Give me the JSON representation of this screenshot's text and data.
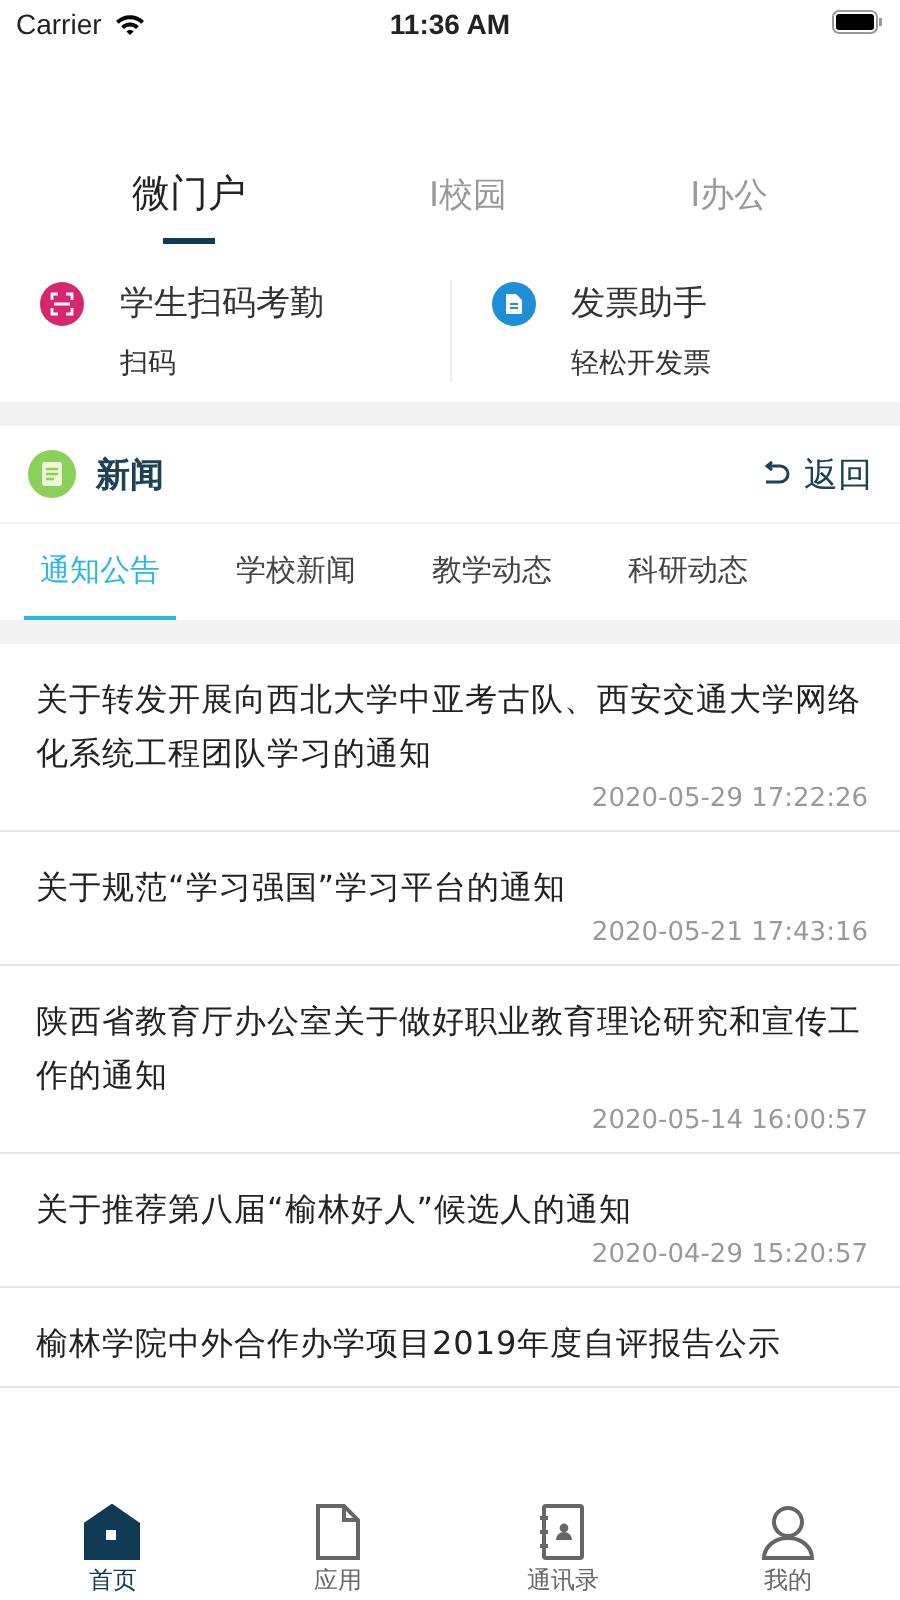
{
  "status_bar": {
    "carrier": "Carrier",
    "time": "11:36 AM"
  },
  "top_tabs": [
    {
      "label": "微门户",
      "selected": true
    },
    {
      "label": "I校园",
      "selected": false
    },
    {
      "label": "I办公",
      "selected": false
    }
  ],
  "shortcuts": [
    {
      "kind": "scan",
      "title": "学生扫码考勤",
      "subtitle": "扫码",
      "color": "#d6266f"
    },
    {
      "kind": "invoice",
      "title": "发票助手",
      "subtitle": "轻松开发票",
      "color": "#1e8fd6"
    }
  ],
  "news": {
    "title": "新闻",
    "back": "返回",
    "tabs": [
      {
        "label": "通知公告",
        "selected": true
      },
      {
        "label": "学校新闻",
        "selected": false
      },
      {
        "label": "教学动态",
        "selected": false
      },
      {
        "label": "科研动态",
        "selected": false
      }
    ],
    "items": [
      {
        "title": "关于转发开展向西北大学中亚考古队、西安交通大学网络化系统工程团队学习的通知",
        "time": "2020-05-29 17:22:26"
      },
      {
        "title": "关于规范“学习强国”学习平台的通知",
        "time": "2020-05-21 17:43:16"
      },
      {
        "title": "陕西省教育厅办公室关于做好职业教育理论研究和宣传工作的通知",
        "time": "2020-05-14 16:00:57"
      },
      {
        "title": "关于推荐第八届“榆林好人”候选人的通知",
        "time": "2020-04-29 15:20:57"
      },
      {
        "title": "榆林学院中外合作办学项目2019年度自评报告公示"
      }
    ]
  },
  "tab_bar": [
    {
      "kind": "home",
      "label": "首页",
      "selected": true
    },
    {
      "kind": "file",
      "label": "应用",
      "selected": false
    },
    {
      "kind": "contacts",
      "label": "通讯录",
      "selected": false
    },
    {
      "kind": "person",
      "label": "我的",
      "selected": false
    }
  ]
}
